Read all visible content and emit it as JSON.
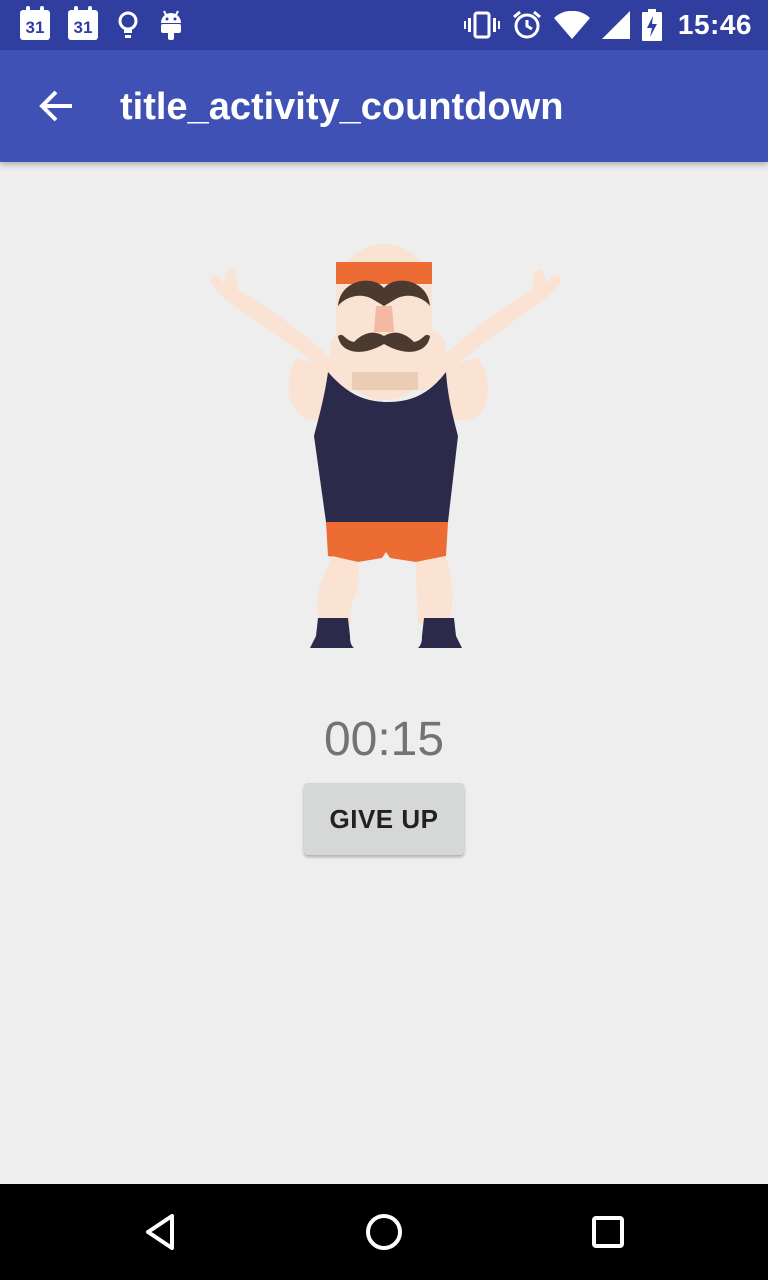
{
  "status_bar": {
    "calendar_day_1": "31",
    "calendar_day_2": "31",
    "time": "15:46",
    "icons": [
      "calendar-icon",
      "calendar-icon",
      "lightbulb-icon",
      "android-icon",
      "vibrate-icon",
      "alarm-icon",
      "wifi-icon",
      "signal-icon",
      "battery-charging-icon"
    ]
  },
  "app_bar": {
    "title": "title_activity_countdown",
    "back_icon": "arrow-back-icon"
  },
  "main": {
    "illustration": "mustached-strongman-arms-raised",
    "timer": "00:15",
    "give_up_label": "GIVE UP"
  },
  "nav_bar": {
    "icons": [
      "back-triangle-icon",
      "home-circle-icon",
      "recents-square-icon"
    ]
  },
  "colors": {
    "status_bar": "#303f9f",
    "app_bar": "#3f51b5",
    "background": "#eeeeee",
    "skin": "#fbe3d3",
    "tank_top": "#2b2a4a",
    "shorts": "#ec6c34",
    "mustache": "#4a3a30"
  }
}
